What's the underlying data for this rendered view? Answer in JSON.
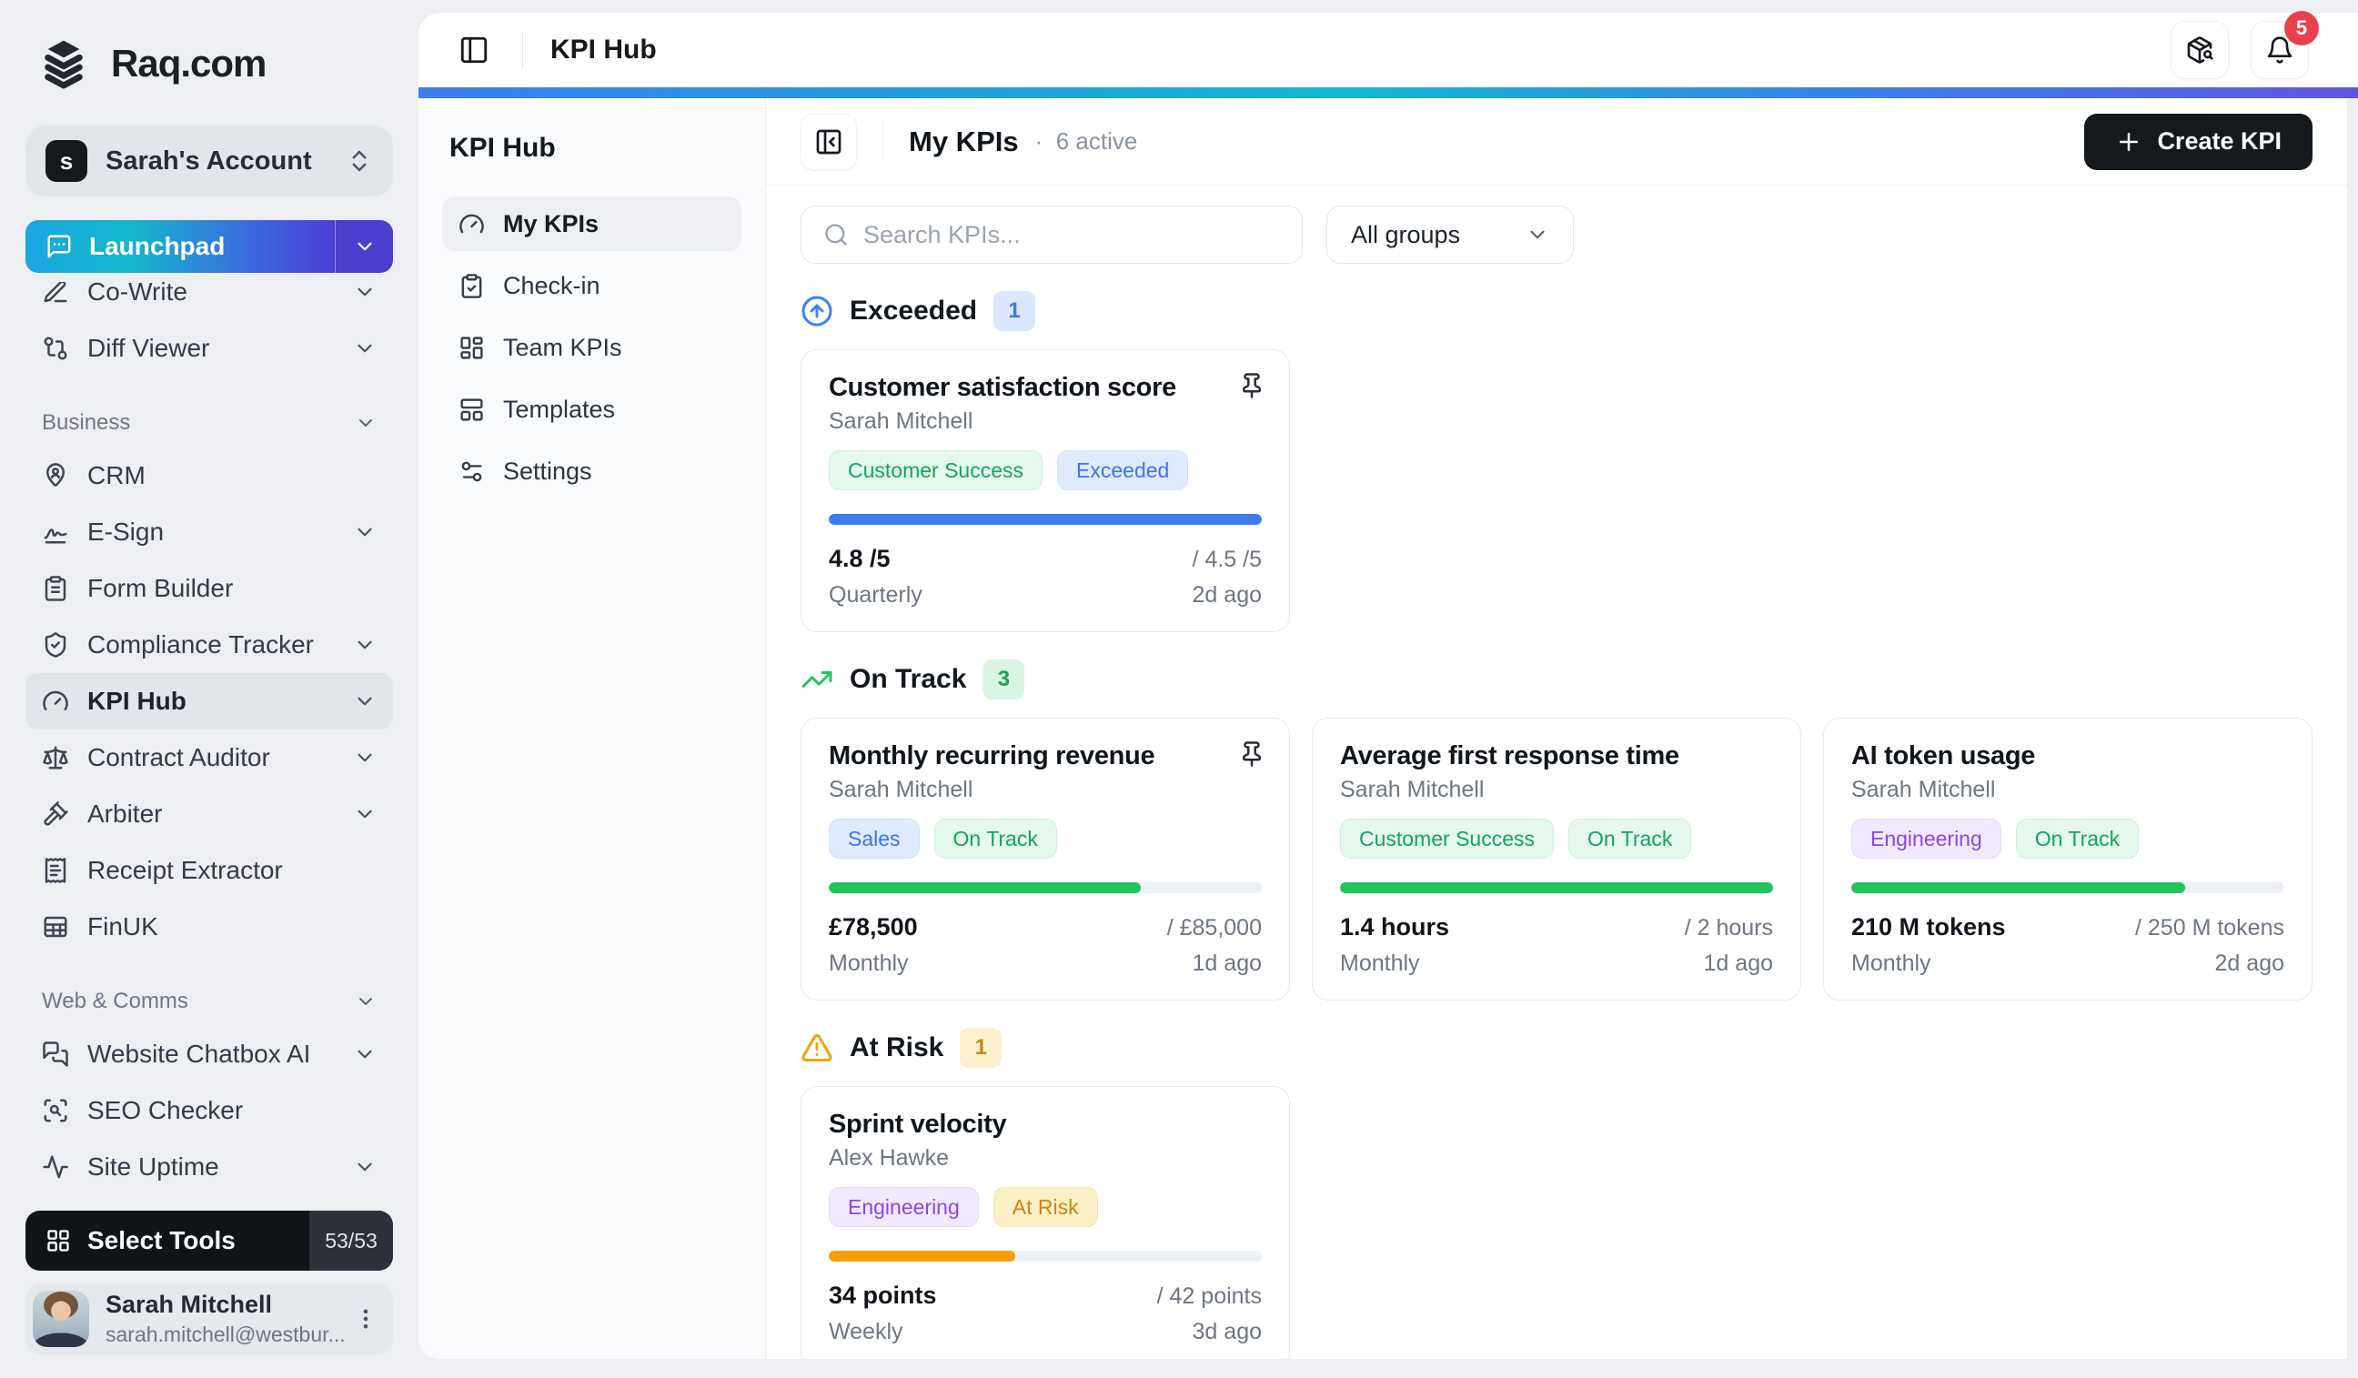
{
  "window": {
    "title": "KPI Hub"
  },
  "colors": {
    "accent_gradient": [
      "#3e7ef2",
      "#16b5d2",
      "#6156e2"
    ],
    "launchpad_gradient": [
      "#1ba6e2",
      "#13b7cb",
      "#4b3ed2"
    ],
    "status_blue": "#3b82f6",
    "status_green": "#22c55e",
    "status_amber": "#f59e0b",
    "notification_red": "#e8414d"
  },
  "sidebar": {
    "brand": "Raq.com",
    "account": {
      "initial": "s",
      "label": "Sarah's Account"
    },
    "launchpad": {
      "label": "Launchpad"
    },
    "items_top": [
      "Co-Write",
      "Diff Viewer"
    ],
    "sections": [
      {
        "label": "Business",
        "items": [
          "CRM",
          "E-Sign",
          "Form Builder",
          "Compliance Tracker",
          "KPI Hub",
          "Contract Auditor",
          "Arbiter",
          "Receipt Extractor",
          "FinUK"
        ]
      },
      {
        "label": "Web & Comms",
        "items": [
          "Website Chatbox AI",
          "SEO Checker",
          "Site Uptime"
        ]
      }
    ],
    "select_tools": {
      "label": "Select Tools",
      "count": "53/53"
    },
    "user": {
      "name": "Sarah Mitchell",
      "email": "sarah.mitchell@westbur..."
    }
  },
  "topbar": {
    "title": "KPI Hub",
    "notification_count": "5"
  },
  "subnav": {
    "title": "KPI Hub",
    "items": [
      "My KPIs",
      "Check-in",
      "Team KPIs",
      "Templates",
      "Settings"
    ]
  },
  "main": {
    "header": {
      "title": "My KPIs",
      "dot": "·",
      "status": "6 active",
      "create_label": "Create KPI"
    },
    "search": {
      "placeholder": "Search KPIs..."
    },
    "filter": {
      "value": "All groups"
    },
    "sections": [
      {
        "label": "Exceeded",
        "count": "1"
      },
      {
        "label": "On Track",
        "count": "3"
      },
      {
        "label": "At Risk",
        "count": "1"
      }
    ],
    "kpis": [
      {
        "title": "Customer satisfaction score",
        "owner": "Sarah Mitchell",
        "tags": [
          "Customer Success",
          "Exceeded"
        ],
        "value": "4.8 /5",
        "target": "/ 4.5 /5",
        "frequency": "Quarterly",
        "updated": "2d ago",
        "progress_width": "100%"
      },
      {
        "title": "Monthly recurring revenue",
        "owner": "Sarah Mitchell",
        "tags": [
          "Sales",
          "On Track"
        ],
        "value": "£78,500",
        "target": "/ £85,000",
        "frequency": "Monthly",
        "updated": "1d ago",
        "progress_width": "72%"
      },
      {
        "title": "Average first response time",
        "owner": "Sarah Mitchell",
        "tags": [
          "Customer Success",
          "On Track"
        ],
        "value": "1.4 hours",
        "target": "/ 2 hours",
        "frequency": "Monthly",
        "updated": "1d ago",
        "progress_width": "100%"
      },
      {
        "title": "AI token usage",
        "owner": "Sarah Mitchell",
        "tags": [
          "Engineering",
          "On Track"
        ],
        "value": "210 M tokens",
        "target": "/ 250 M tokens",
        "frequency": "Monthly",
        "updated": "2d ago",
        "progress_width": "77%"
      },
      {
        "title": "Sprint velocity",
        "owner": "Alex Hawke",
        "tags": [
          "Engineering",
          "At Risk"
        ],
        "value": "34 points",
        "target": "/ 42 points",
        "frequency": "Weekly",
        "updated": "3d ago",
        "progress_width": "43%"
      }
    ]
  }
}
